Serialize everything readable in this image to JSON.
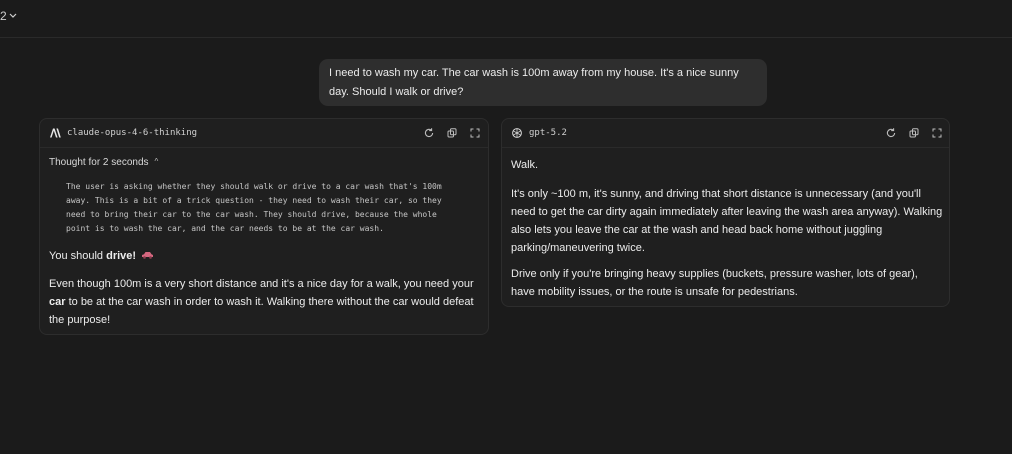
{
  "topbar": {
    "selector_label": "2"
  },
  "user_message": "I need to wash my car. The car wash is 100m away from my house. It's a nice sunny day. Should I walk or drive?",
  "left_panel": {
    "model_name": "claude-opus-4-6-thinking",
    "model_icon": "anthropic-logo-icon",
    "thought_label": "Thought for 2 seconds",
    "thought_lines": [
      "The user is asking whether they should walk or drive to a car wash that's 100m",
      "away. This is a bit of a trick question - they need to wash their car, so they",
      "need to bring their car to the car wash. They should drive, because the whole",
      "point is to wash the car, and the car needs to be at the car wash."
    ],
    "answer_1_prefix": "You should ",
    "answer_1_bold": "drive!",
    "answer_1_emoji_name": "car-emoji-icon",
    "answer_2_before": "Even though 100m is a very short distance and it's a nice day for a walk, you need your ",
    "answer_2_bold": "car",
    "answer_2_after": " to be at the car wash in order to wash it. Walking there without the car would defeat the purpose!"
  },
  "right_panel": {
    "model_name": "gpt-5.2",
    "model_icon": "openai-logo-icon",
    "p1": "Walk.",
    "p2": "It's only ~100 m, it's sunny, and driving that short distance is unnecessary (and you'll need to get the car dirty again immediately after leaving the wash area anyway). Walking also lets you leave the car at the wash and head back home without juggling parking/maneuvering twice.",
    "p3": "Drive only if you're bringing heavy supplies (buckets, pressure washer, lots of gear), have mobility issues, or the route is unsafe for pedestrians."
  },
  "header_actions": [
    "regenerate-icon",
    "copy-icon",
    "expand-icon"
  ],
  "colors": {
    "background": "#1b1b1b",
    "panel": "#1f1f1f",
    "bubble": "#2e2e2e",
    "emoji": "#d5677f"
  }
}
